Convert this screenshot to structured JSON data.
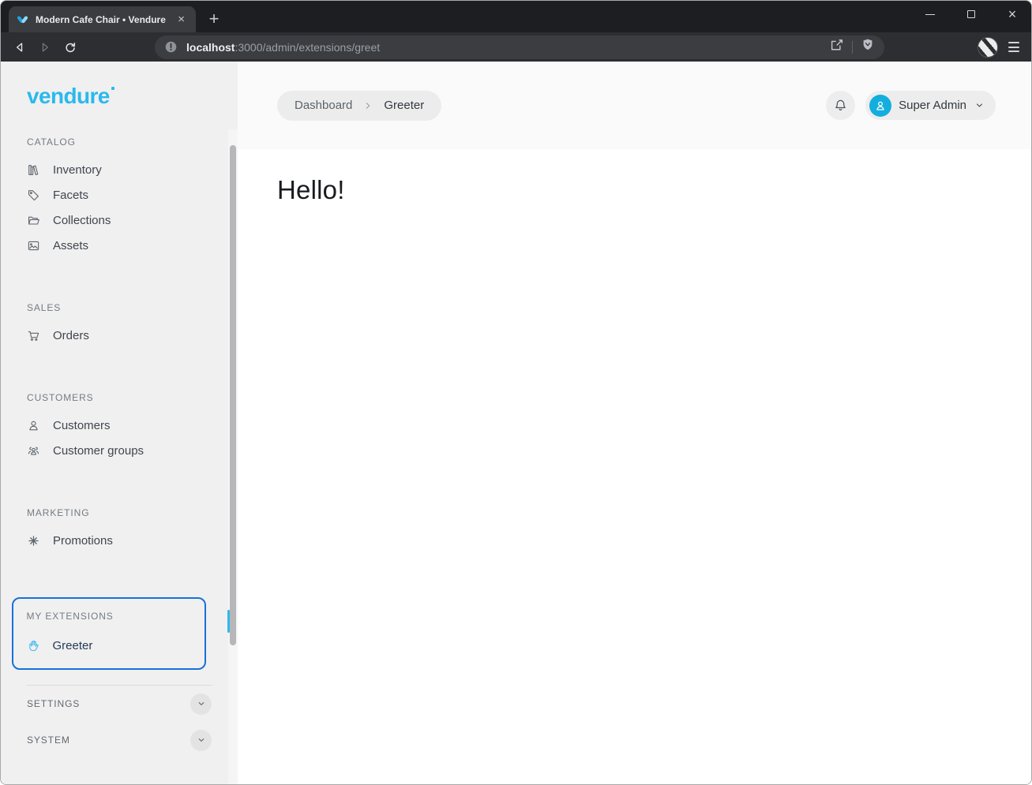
{
  "browser": {
    "tab_title": "Modern Cafe Chair • Vendure",
    "tab_close_glyph": "×",
    "new_tab_glyph": "+",
    "window_close_glyph": "×",
    "url_host": "localhost",
    "url_path": ":3000/admin/extensions/greet"
  },
  "sidebar": {
    "logo_text": "vendure",
    "sections": [
      {
        "header": "CATALOG",
        "items": [
          {
            "label": "Inventory",
            "icon": "library-icon"
          },
          {
            "label": "Facets",
            "icon": "tag-icon"
          },
          {
            "label": "Collections",
            "icon": "folder-icon"
          },
          {
            "label": "Assets",
            "icon": "image-icon"
          }
        ]
      },
      {
        "header": "SALES",
        "items": [
          {
            "label": "Orders",
            "icon": "cart-icon"
          }
        ]
      },
      {
        "header": "CUSTOMERS",
        "items": [
          {
            "label": "Customers",
            "icon": "user-icon"
          },
          {
            "label": "Customer groups",
            "icon": "users-icon"
          }
        ]
      },
      {
        "header": "MARKETING",
        "items": [
          {
            "label": "Promotions",
            "icon": "asterisk-icon"
          }
        ]
      }
    ],
    "extensions": {
      "header": "MY EXTENSIONS",
      "items": [
        {
          "label": "Greeter",
          "icon": "hand-icon"
        }
      ]
    },
    "collapsed_sections": [
      {
        "label": "SETTINGS"
      },
      {
        "label": "SYSTEM"
      }
    ]
  },
  "header": {
    "breadcrumb": {
      "items": [
        "Dashboard",
        "Greeter"
      ]
    },
    "user_name": "Super Admin"
  },
  "content": {
    "greeting": "Hello!"
  },
  "colors": {
    "brand": "#2bb9ec",
    "extension_highlight_border": "#1671d9",
    "active_indicator": "#2fb9ec",
    "avatar_background": "#14aede"
  }
}
